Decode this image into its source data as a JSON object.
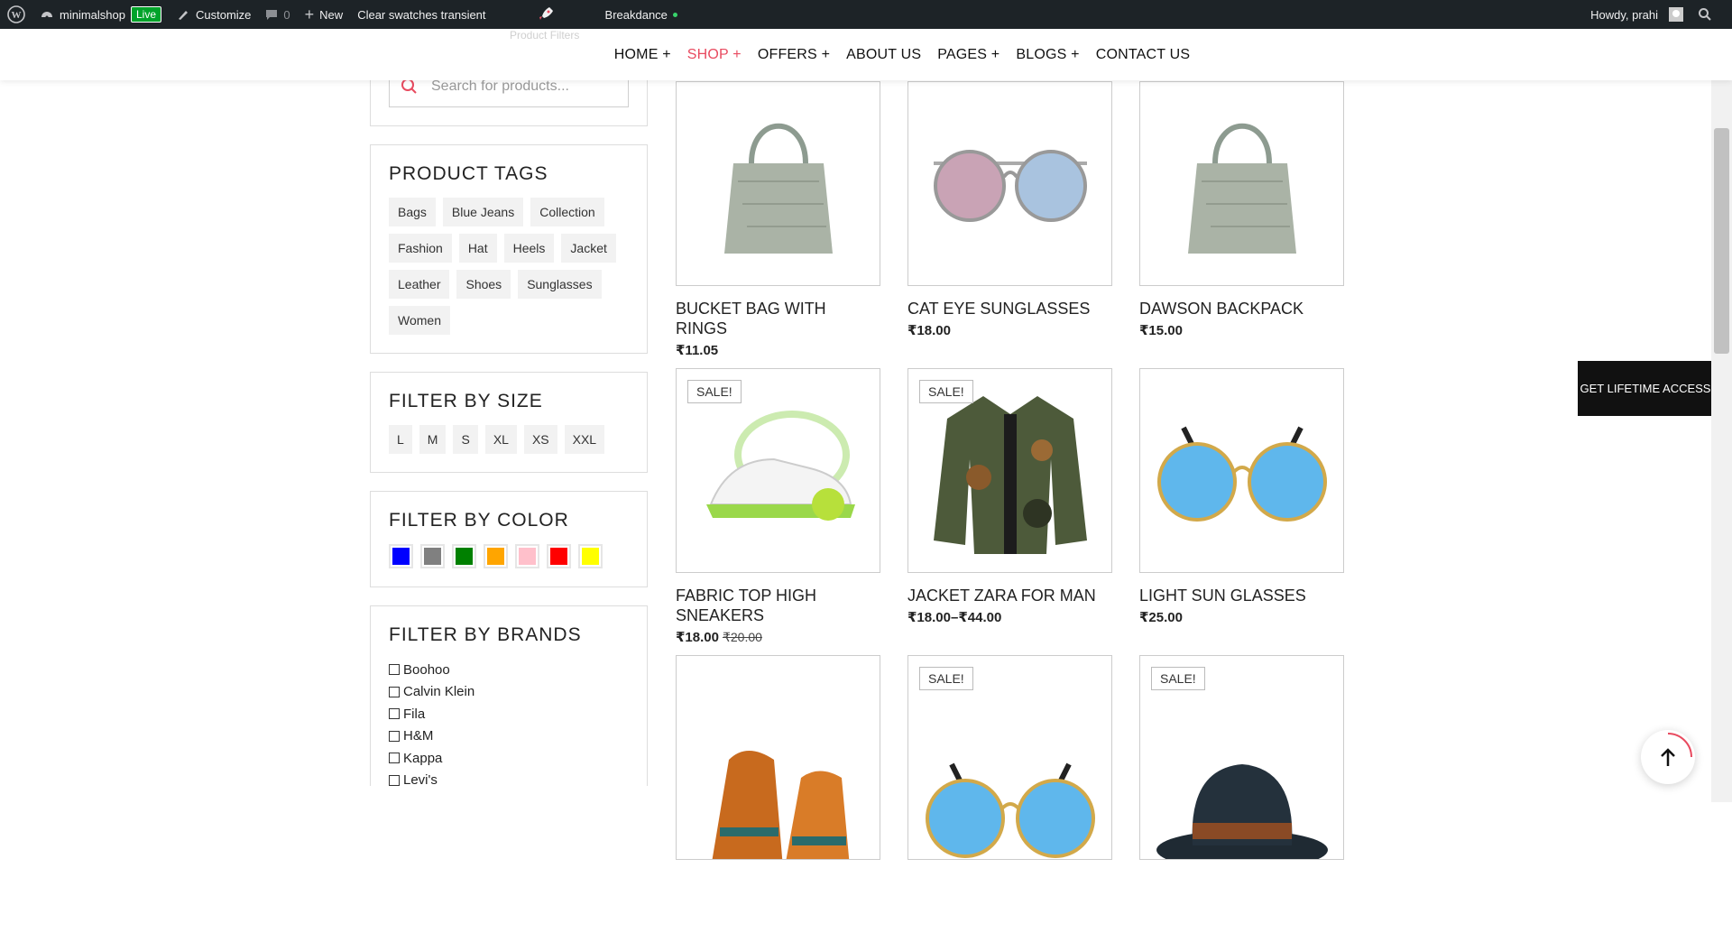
{
  "adminbar": {
    "site_name": "minimalshop",
    "live": "Live",
    "customize": "Customize",
    "comments": "0",
    "new": "New",
    "clear": "Clear swatches transient",
    "breakdance": "Breakdance",
    "greeting": "Howdy, prahi"
  },
  "ghost_label": "Product Filters",
  "nav": {
    "items": [
      {
        "label": "HOME +"
      },
      {
        "label": "SHOP +"
      },
      {
        "label": "OFFERS +"
      },
      {
        "label": "ABOUT US"
      },
      {
        "label": "PAGES +"
      },
      {
        "label": "BLOGS +"
      },
      {
        "label": "CONTACT US"
      }
    ]
  },
  "sidebar": {
    "search_placeholder": "Search for products...",
    "tags_title": "PRODUCT TAGS",
    "tags": [
      "Bags",
      "Blue Jeans",
      "Collection",
      "Fashion",
      "Hat",
      "Heels",
      "Jacket",
      "Leather",
      "Shoes",
      "Sunglasses",
      "Women"
    ],
    "size_title": "FILTER BY SIZE",
    "sizes": [
      "L",
      "M",
      "S",
      "XL",
      "XS",
      "XXL"
    ],
    "color_title": "FILTER BY COLOR",
    "colors": [
      "#0000ff",
      "#808080",
      "#008000",
      "#ffa500",
      "#ffc0cb",
      "#ff0000",
      "#ffff00"
    ],
    "brands_title": "FILTER BY BRANDS",
    "brands": [
      "Boohoo",
      "Calvin Klein",
      "Fila",
      "H&M",
      "Kappa",
      "Levi's"
    ]
  },
  "products": [
    {
      "name": "BUCKET BAG WITH RINGS",
      "price": "₹11.05",
      "old_price": "",
      "sale": "",
      "image": "handbag-icon"
    },
    {
      "name": "CAT EYE SUNGLASSES",
      "price": "₹18.00",
      "old_price": "",
      "sale": "",
      "image": "sunglasses-icon"
    },
    {
      "name": "DAWSON BACKPACK",
      "price": "₹15.00",
      "old_price": "",
      "sale": "",
      "image": "handbag-icon"
    },
    {
      "name": "FABRIC TOP HIGH SNEAKERS",
      "price": "₹18.00",
      "old_price": "₹20.00",
      "sale": "SALE!",
      "image": "sneaker-icon"
    },
    {
      "name": "JACKET ZARA FOR MAN",
      "price": "₹18.00–₹44.00",
      "old_price": "",
      "sale": "SALE!",
      "image": "jacket-icon"
    },
    {
      "name": "LIGHT SUN GLASSES",
      "price": "₹25.00",
      "old_price": "",
      "sale": "",
      "image": "round-glasses-icon"
    },
    {
      "name": "",
      "price": "",
      "old_price": "",
      "sale": "",
      "image": "heels-icon"
    },
    {
      "name": "",
      "price": "",
      "old_price": "",
      "sale": "SALE!",
      "image": "round-glasses-icon"
    },
    {
      "name": "",
      "price": "",
      "old_price": "",
      "sale": "SALE!",
      "image": "hat-icon"
    }
  ],
  "cta": {
    "lifetime": "GET LIFETIME ACCESS"
  }
}
